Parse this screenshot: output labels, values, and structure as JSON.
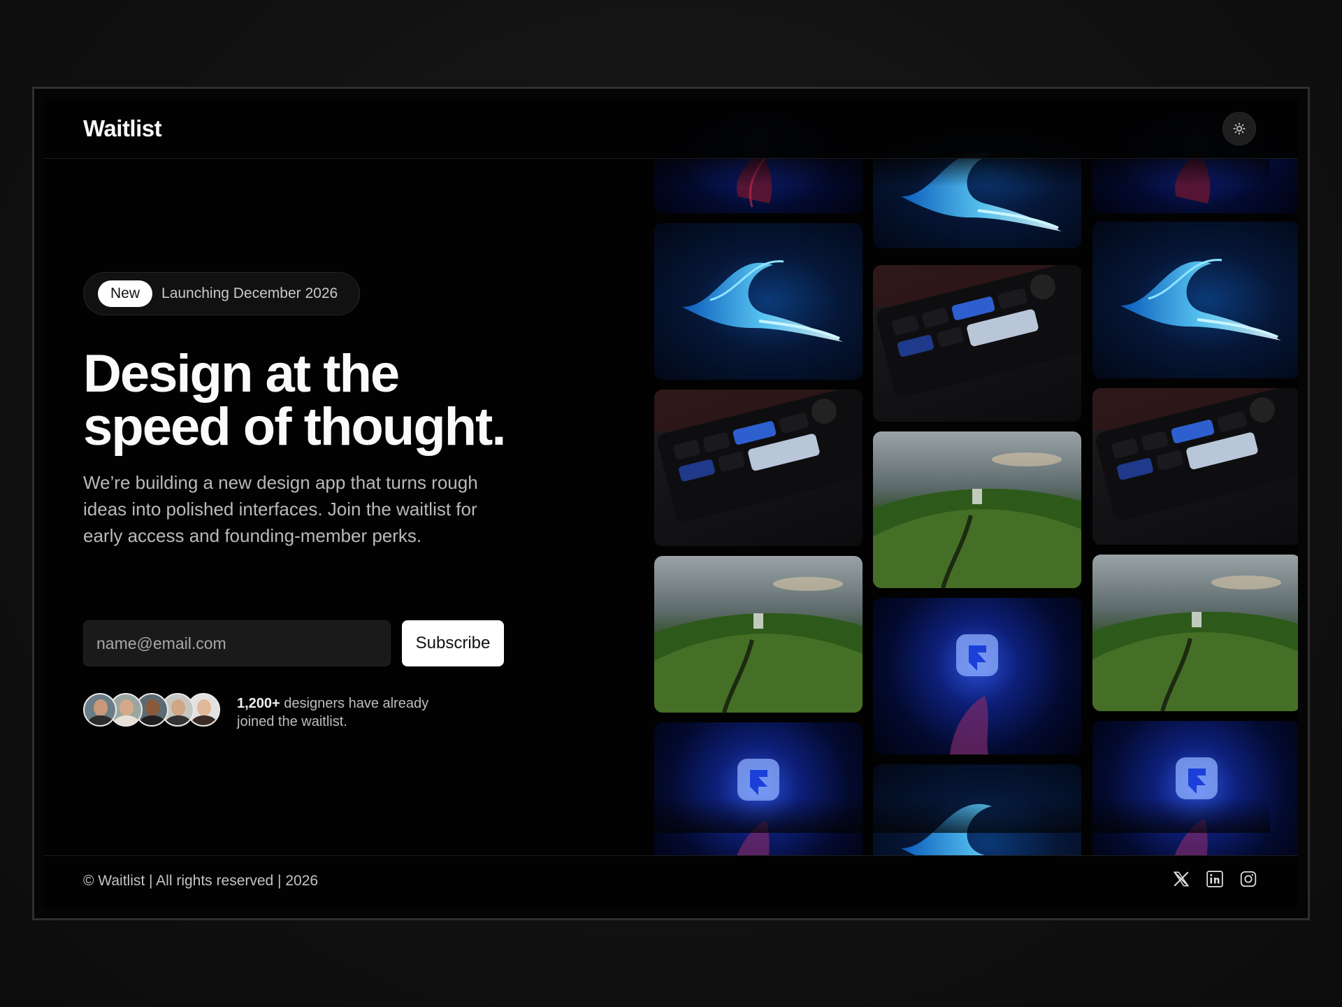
{
  "header": {
    "brand": "Waitlist",
    "theme_toggle_icon": "sun-icon"
  },
  "hero": {
    "badge_label": "New",
    "badge_text": "Launching December 2026",
    "headline_line1": "Design at the",
    "headline_line2": "speed of thought.",
    "subtitle": "We’re building a new design app that turns rough ideas into polished interfaces. Join the waitlist for early access and founding-member perks."
  },
  "signup": {
    "email_placeholder": "name@email.com",
    "subscribe_label": "Subscribe"
  },
  "social_proof": {
    "count": "1,200+",
    "text": " designers have already joined the waitlist."
  },
  "gallery": {
    "columns": [
      [
        "glow",
        "wave",
        "keys",
        "hill",
        "glow"
      ],
      [
        "wave",
        "keys",
        "hill",
        "glow",
        "wave"
      ],
      [
        "glow",
        "wave",
        "keys",
        "hill",
        "glow"
      ]
    ]
  },
  "footer": {
    "copyright": "© Waitlist | All rights reserved | 2026",
    "icons": [
      "x-icon",
      "linkedin-icon",
      "instagram-icon"
    ]
  },
  "colors": {
    "background": "#020202",
    "accent_blue": "#2a5bff",
    "text_primary": "#fafafa",
    "text_secondary": "#b9b9b9"
  }
}
